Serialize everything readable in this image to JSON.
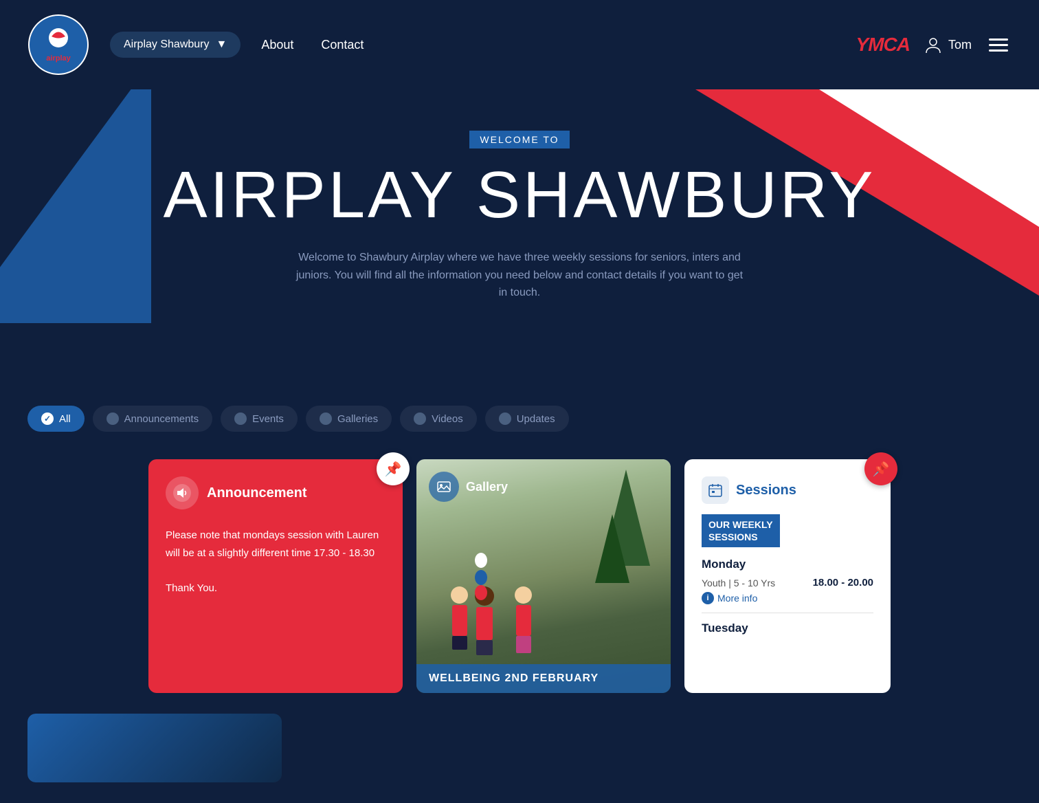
{
  "header": {
    "logo_alt": "Airplay Logo",
    "nav_dropdown_label": "Airplay Shawbury",
    "nav_links": [
      "About",
      "Contact"
    ],
    "ymca_label": "YMCA",
    "user_name": "Tom",
    "hamburger_label": "Menu"
  },
  "hero": {
    "welcome_label": "WELCOME TO",
    "title": "AIRPLAY SHAWBURY",
    "description": "Welcome to Shawbury Airplay where we have three weekly sessions for seniors, inters and juniors. You will find all the information you need below and contact details if you want to get in touch."
  },
  "filters": {
    "tabs": [
      {
        "id": "all",
        "label": "All",
        "active": true
      },
      {
        "id": "announcements",
        "label": "Announcements",
        "active": false
      },
      {
        "id": "events",
        "label": "Events",
        "active": false
      },
      {
        "id": "galleries",
        "label": "Galleries",
        "active": false
      },
      {
        "id": "videos",
        "label": "Videos",
        "active": false
      },
      {
        "id": "updates",
        "label": "Updates",
        "active": false
      }
    ]
  },
  "cards": {
    "announcement": {
      "type_label": "Announcement",
      "body": "Please note that mondays session with Lauren will be at a slightly different time 17.30 - 18.30\n\nThank You."
    },
    "gallery": {
      "type_label": "Gallery",
      "footer_text": "WELLBEING 2ND FEBRUARY"
    },
    "sessions": {
      "title": "Sessions",
      "weekly_title": "OUR WEEKLY SESSIONS",
      "days": [
        {
          "day": "Monday",
          "entries": [
            {
              "type": "Youth | 5 - 10 Yrs",
              "time": "18.00 - 20.00",
              "more_info": "More info"
            }
          ]
        },
        {
          "day": "Tuesday",
          "entries": []
        }
      ]
    }
  }
}
